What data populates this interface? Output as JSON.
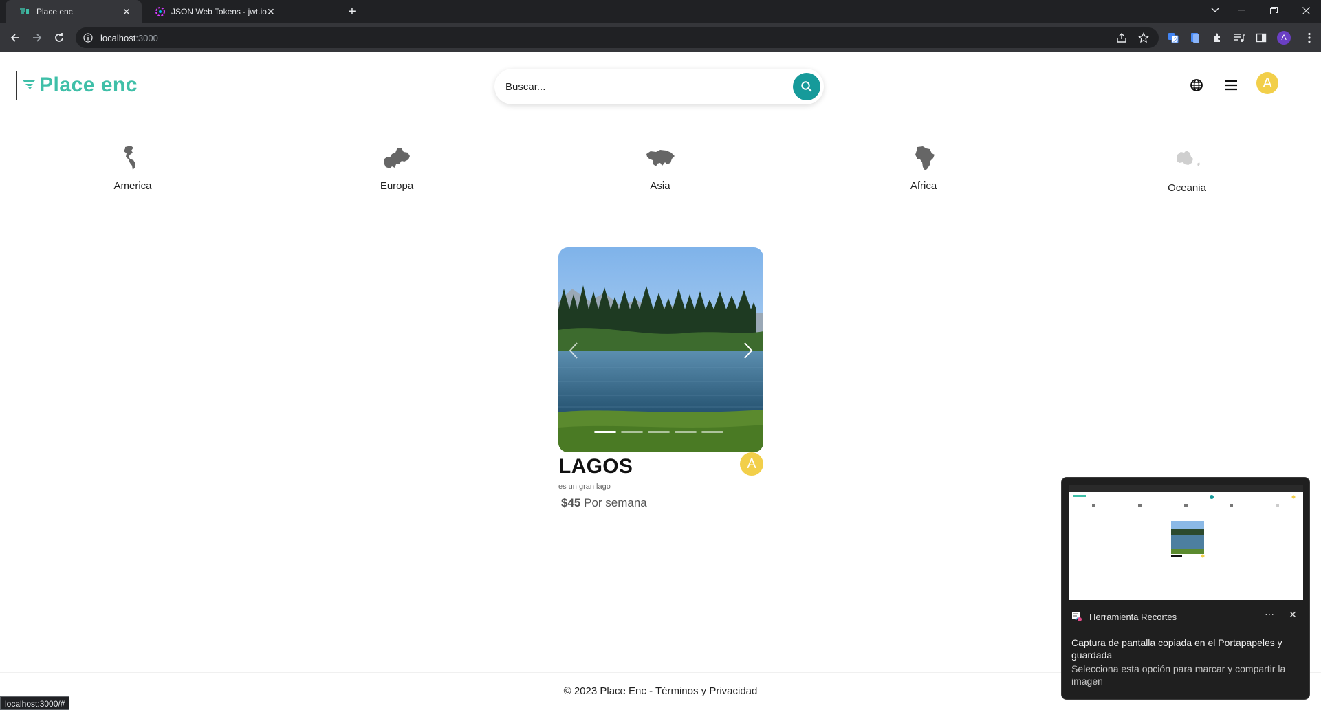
{
  "browser": {
    "tabs": [
      {
        "title": "Place enc",
        "active": true
      },
      {
        "title": "JSON Web Tokens - jwt.io",
        "active": false
      }
    ],
    "url_host": "localhost",
    "url_port": ":3000",
    "profile_initial": "A",
    "status_url": "localhost:3000/#"
  },
  "header": {
    "logo_text": "Place enc",
    "search_placeholder": "Buscar...",
    "avatar_initial": "A"
  },
  "continents": [
    {
      "label": "America",
      "icon": "americas-map-icon"
    },
    {
      "label": "Europa",
      "icon": "europe-map-icon"
    },
    {
      "label": "Asia",
      "icon": "asia-map-icon"
    },
    {
      "label": "Africa",
      "icon": "africa-map-icon"
    },
    {
      "label": "Oceania",
      "icon": "oceania-map-icon"
    }
  ],
  "card": {
    "title": "LAGOS",
    "description": "es un gran lago",
    "price_amount": "$45",
    "price_period": "Por semana",
    "avatar_initial": "A",
    "carousel_total": 5,
    "carousel_active": 1
  },
  "footer": {
    "text": "© 2023 Place Enc - ",
    "terms": "Términos",
    "and": " y ",
    "privacy": "Privacidad"
  },
  "toast": {
    "app_name": "Herramienta Recortes",
    "title": "Captura de pantalla copiada en el Portapapeles y guardada",
    "subtitle": "Selecciona esta opción para marcar y compartir la imagen"
  },
  "colors": {
    "brand": "#3fbfa8",
    "search_button": "#169a9a",
    "avatar": "#f2cf4a"
  }
}
